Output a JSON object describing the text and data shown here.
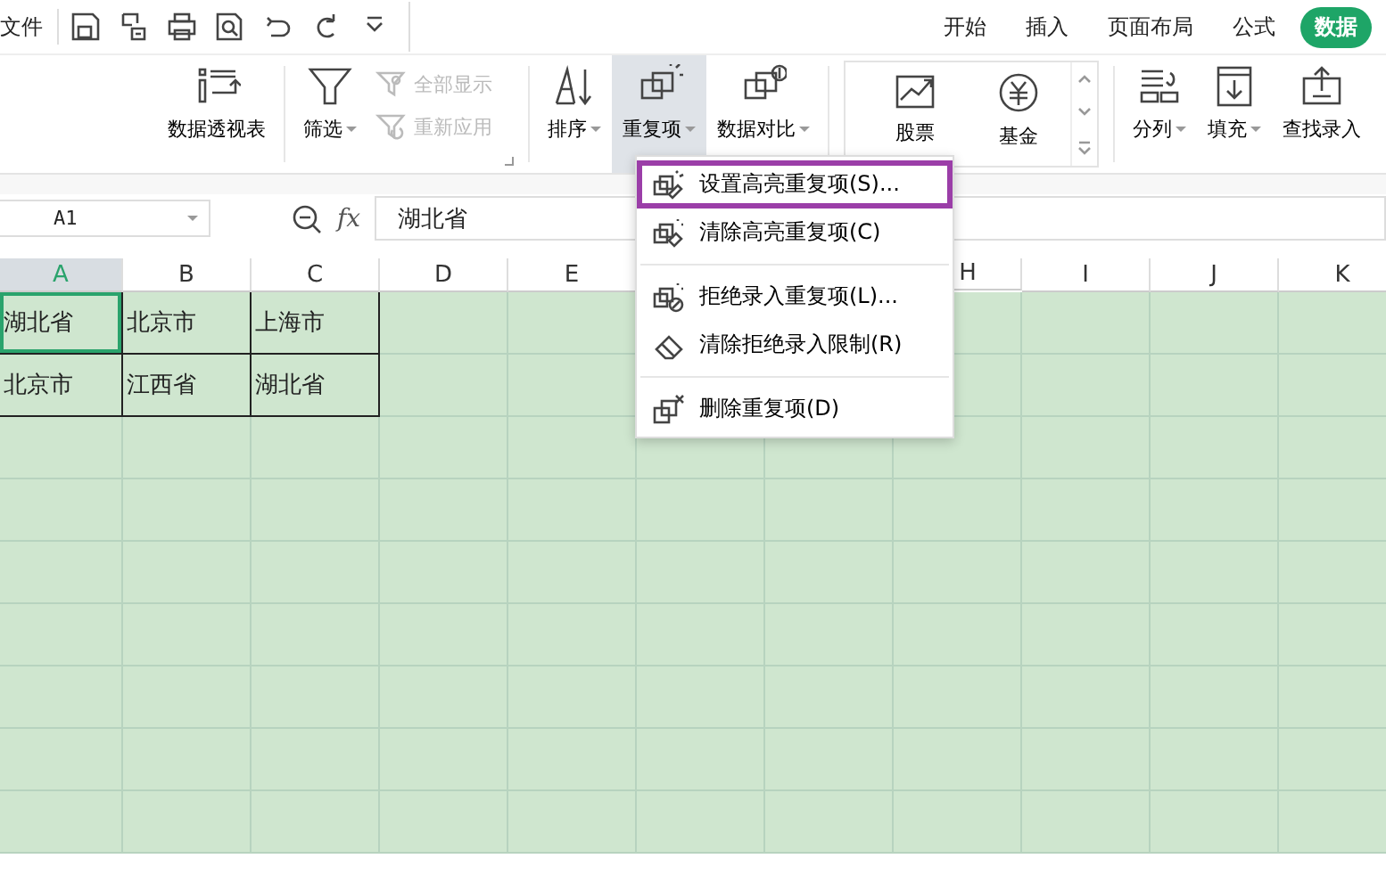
{
  "menu_bar": {
    "file": "文件"
  },
  "tabs": [
    {
      "label": "开始",
      "selected": false
    },
    {
      "label": "插入",
      "selected": false
    },
    {
      "label": "页面布局",
      "selected": false
    },
    {
      "label": "公式",
      "selected": false
    },
    {
      "label": "数据",
      "selected": true
    }
  ],
  "ribbon": [
    {
      "kind": "big",
      "label": "数据透视表",
      "dropdown": false,
      "pressed": false
    },
    {
      "kind": "big",
      "label": "筛选",
      "dropdown": true,
      "pressed": false
    },
    {
      "kind": "stack",
      "items": [
        {
          "label": "全部显示",
          "disabled": true
        },
        {
          "label": "重新应用",
          "disabled": true
        }
      ]
    },
    {
      "kind": "big",
      "label": "排序",
      "dropdown": true,
      "pressed": false
    },
    {
      "kind": "big",
      "label": "重复项",
      "dropdown": true,
      "pressed": true
    },
    {
      "kind": "big",
      "label": "数据对比",
      "dropdown": true,
      "pressed": false
    },
    {
      "kind": "gallery",
      "items": [
        {
          "label": "股票"
        },
        {
          "label": "基金"
        }
      ]
    },
    {
      "kind": "big",
      "label": "分列",
      "dropdown": true,
      "pressed": false
    },
    {
      "kind": "big",
      "label": "填充",
      "dropdown": true,
      "pressed": false
    },
    {
      "kind": "big",
      "label": "查找录入",
      "dropdown": false,
      "pressed": false
    }
  ],
  "name_box": "A1",
  "fx_label": "fx",
  "formula": "湖北省",
  "columns": [
    {
      "label": "A",
      "selected": true
    },
    {
      "label": "B",
      "selected": false
    },
    {
      "label": "C",
      "selected": false
    },
    {
      "label": "D",
      "selected": false
    },
    {
      "label": "E",
      "selected": false
    },
    {},
    {},
    {
      "label": "H",
      "selected": false
    },
    {
      "label": "I",
      "selected": false
    },
    {
      "label": "J",
      "selected": false
    },
    {
      "label": "K",
      "selected": false
    }
  ],
  "rows": [
    [
      "湖北省",
      "北京市",
      "上海市"
    ],
    [
      "北京市",
      "江西省",
      "湖北省"
    ]
  ],
  "context_menu": {
    "groups": [
      [
        {
          "label": "设置高亮重复项(S)...",
          "selected": true
        },
        {
          "label": "清除高亮重复项(C)",
          "selected": false
        }
      ],
      [
        {
          "label": "拒绝录入重复项(L)...",
          "selected": false
        },
        {
          "label": "清除拒绝录入限制(R)",
          "selected": false
        }
      ],
      [
        {
          "label": "删除重复项(D)",
          "selected": false
        }
      ]
    ]
  }
}
